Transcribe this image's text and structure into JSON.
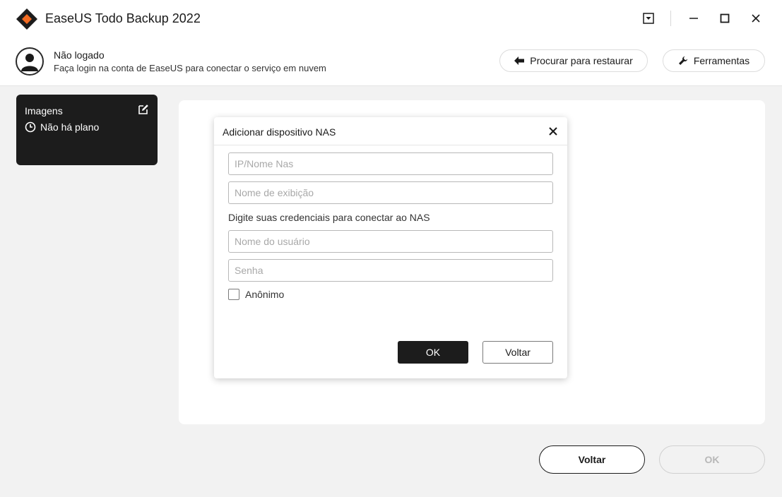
{
  "app": {
    "title": "EaseUS Todo Backup 2022",
    "accent_color": "#f26a21"
  },
  "window_controls": {
    "icons": [
      "dropdown-menu-icon",
      "minimize-icon",
      "maximize-icon",
      "close-icon"
    ]
  },
  "account": {
    "name": "Não logado",
    "subtitle": "Faça login na conta de EaseUS para conectar o serviço em nuvem",
    "restore_label": "Procurar para restaurar",
    "tools_label": "Ferramentas"
  },
  "plan_card": {
    "title": "Imagens",
    "status": "Não há plano"
  },
  "dialog": {
    "title": "Adicionar dispositivo NAS",
    "ip_placeholder": "IP/Nome Nas",
    "display_name_placeholder": "Nome de exibição",
    "credentials_label": "Digite suas credenciais para conectar ao NAS",
    "username_placeholder": "Nome do usuário",
    "password_placeholder": "Senha",
    "anonymous_label": "Anônimo",
    "anonymous_checked": false,
    "ok_label": "OK",
    "back_label": "Voltar"
  },
  "footer": {
    "back_label": "Voltar",
    "ok_label": "OK",
    "ok_enabled": false
  }
}
